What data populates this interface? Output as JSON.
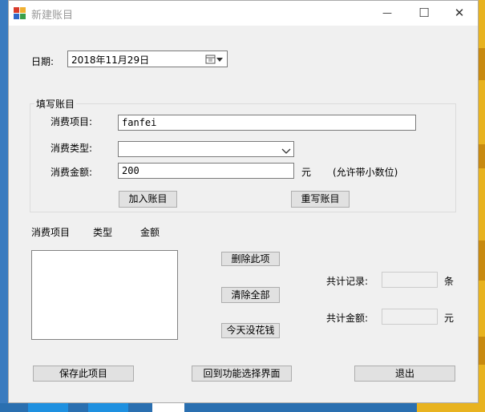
{
  "window": {
    "title": "新建账目",
    "minimize_glyph": "—",
    "maximize_glyph": "☐",
    "close_glyph": "✕"
  },
  "date": {
    "label": "日期:",
    "value": "2018年11月29日"
  },
  "entry_group": {
    "title": "填写账目",
    "item_label": "消费项目:",
    "item_value": "fanfei",
    "type_label": "消费类型:",
    "type_value": "",
    "amount_label": "消费金额:",
    "amount_value": "200",
    "amount_unit": "元",
    "amount_hint": "(允许带小数位)",
    "add_button": "加入账目",
    "reset_button": "重写账目"
  },
  "list": {
    "columns": [
      "消费项目",
      "类型",
      "金额"
    ],
    "items": []
  },
  "actions": {
    "delete_item": "删除此项",
    "clear_all": "清除全部",
    "no_spending": "今天没花钱"
  },
  "summary": {
    "records_label": "共计记录:",
    "records_value": "",
    "records_unit": "条",
    "total_label": "共计金额:",
    "total_value": "",
    "total_unit": "元"
  },
  "footer": {
    "save": "保存此项目",
    "back": "回到功能选择界面",
    "exit": "退出"
  },
  "colors": {
    "window_bg": "#f0f0f0",
    "button_bg": "#e1e1e1",
    "button_border": "#adadad"
  }
}
